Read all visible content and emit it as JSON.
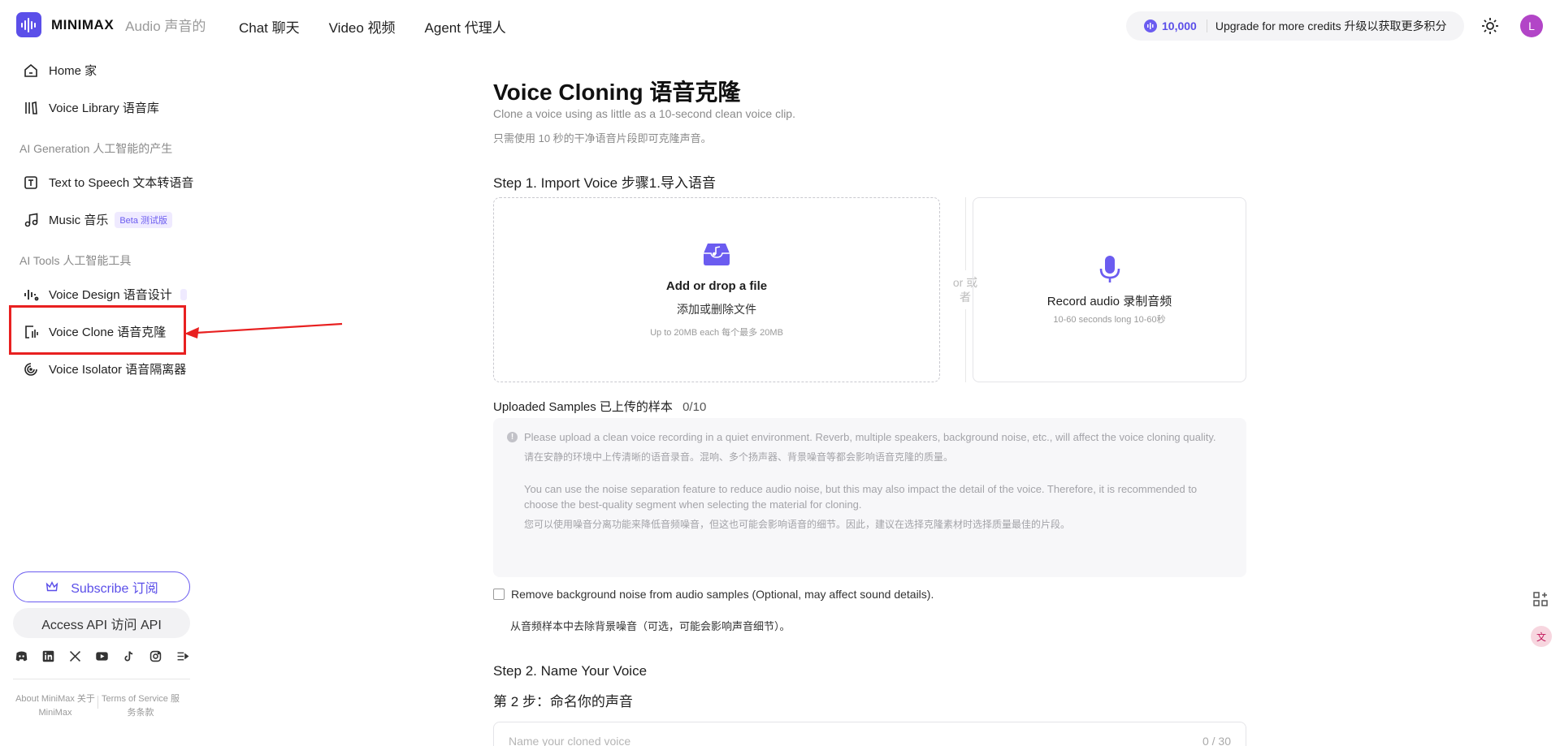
{
  "brand": {
    "name": "MINIMAX",
    "product": "Audio 声音的"
  },
  "topnav": [
    "Chat 聊天",
    "Video 视频",
    "Agent 代理人"
  ],
  "credits": {
    "amount": "10,000",
    "upgrade_text": "Upgrade for more credits 升级以获取更多积分"
  },
  "user": {
    "avatar_letter": "L"
  },
  "sidebar": {
    "home": "Home 家",
    "voice_library": "Voice Library 语音库",
    "section_ai_generation": "AI Generation 人工智能的产生",
    "text_to_speech": "Text to Speech 文本转语音",
    "music": "Music 音乐",
    "music_badge": "Beta 测试版",
    "section_ai_tools": "AI Tools 人工智能工具",
    "voice_design": "Voice Design 语音设计",
    "voice_clone": "Voice Clone 语音克隆",
    "voice_isolator": "Voice Isolator 语音隔离器",
    "subscribe": "Subscribe 订阅",
    "access_api": "Access API 访问 API",
    "socials": [
      "discord-icon",
      "linkedin-icon",
      "x-icon",
      "youtube-icon",
      "tiktok-icon",
      "instagram-icon",
      "more-icon"
    ],
    "footer": {
      "about": "About MiniMax 关于 MiniMax",
      "terms": "Terms of Service 服务条款"
    }
  },
  "main": {
    "title": "Voice Cloning 语音克隆",
    "subtitle": "Clone a voice using as little as a 10-second clean voice clip.",
    "subtitle_zh": "只需使用 10 秒的干净语音片段即可克隆声音。",
    "step1": "Step 1. Import Voice 步骤1.导入语音",
    "dropzone": {
      "title": "Add or drop a file",
      "subtitle": "添加或删除文件",
      "limit": "Up to 20MB each 每个最多 20MB"
    },
    "or_text": "or 或者",
    "record": {
      "title": "Record audio 录制音频",
      "subtitle": "10-60 seconds long 10-60秒"
    },
    "uploaded_label": "Uploaded Samples 已上传的样本",
    "uploaded_count": "0/10",
    "notice": {
      "p1": "Please upload a clean voice recording in a quiet environment. Reverb, multiple speakers, background noise, etc., will affect the voice cloning quality.",
      "p1_zh": "请在安静的环境中上传清晰的语音录音。混响、多个扬声器、背景噪音等都会影响语音克隆的质量。",
      "p2": "You can use the noise separation feature to reduce audio noise, but this may also impact the detail of the voice. Therefore, it is recommended to choose the best-quality segment when selecting the material for cloning.",
      "p2_zh": "您可以使用噪音分离功能来降低音频噪音，但这也可能会影响语音的细节。因此，建议在选择克隆素材时选择质量最佳的片段。"
    },
    "noise_checkbox": "Remove background noise from audio samples (Optional, may affect sound details).",
    "noise_checkbox_zh": "从音频样本中去除背景噪音（可选，可能会影响声音细节）。",
    "step2": "Step 2. Name Your Voice",
    "step2_zh": "第 2 步：命名你的声音",
    "name_placeholder": "Name your cloned voice",
    "name_count": "0 / 30"
  },
  "colors": {
    "accent": "#5b4fe9",
    "highlight": "#e82020",
    "avatar": "#b245c7"
  }
}
